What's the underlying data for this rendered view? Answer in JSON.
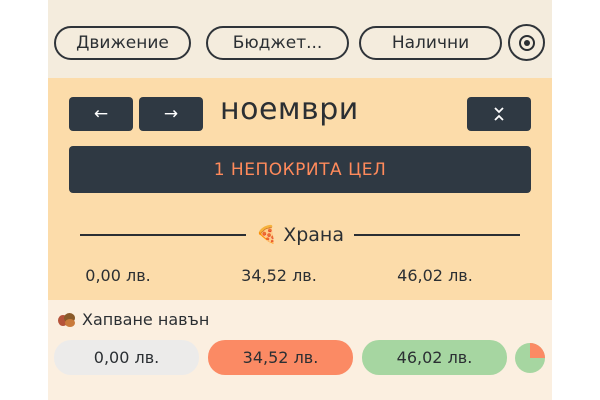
{
  "nav": {
    "tabs": [
      {
        "label": "Движение"
      },
      {
        "label": "Бюджет..."
      },
      {
        "label": "Налични"
      }
    ],
    "goal_icon": "target-icon"
  },
  "month": {
    "prev_icon": "arrow-left-icon",
    "next_icon": "arrow-right-icon",
    "prev_glyph": "←",
    "next_glyph": "→",
    "title": "ноември",
    "collapse_icon": "collapse-icon",
    "alert_label": "1 НЕПОКРИТА ЦЕЛ"
  },
  "category": {
    "name": "Храна",
    "icon": "pizza-icon",
    "icon_glyph": "🍕",
    "amounts": [
      "0,00 лв.",
      "34,52 лв.",
      "46,02 лв."
    ]
  },
  "subcategory": {
    "name": "Хапване навън",
    "icon": "beans-icon",
    "amounts": [
      "0,00 лв.",
      "34,52 лв.",
      "46,02 лв."
    ],
    "progress_fraction": 0.25,
    "progress_icon": "progress-pie-icon"
  },
  "colors": {
    "background": "#f3ead9",
    "month_panel": "#fcdcaa",
    "dark_button": "#2f3943",
    "alert_text": "#ff8a5b",
    "chip_neutral": "#ecebea",
    "chip_spent": "#fb8a64",
    "chip_available": "#a6d6a1"
  }
}
